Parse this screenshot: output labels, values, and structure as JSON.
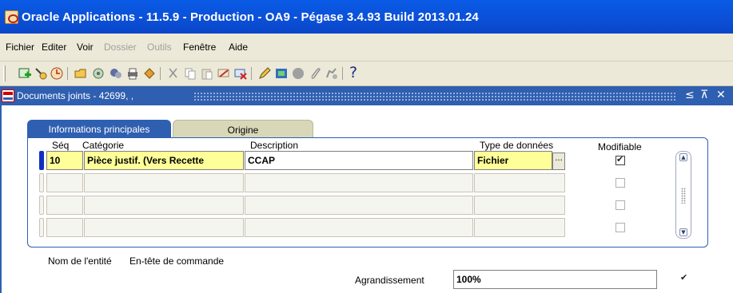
{
  "window": {
    "title": "Oracle Applications - 11.5.9 - Production - OA9 - Pégase 3.4.93 Build 2013.01.24"
  },
  "menubar": {
    "items": [
      {
        "label": "Fichier",
        "enabled": true
      },
      {
        "label": "Editer",
        "enabled": true
      },
      {
        "label": "Voir",
        "enabled": true
      },
      {
        "label": "Dossier",
        "enabled": false
      },
      {
        "label": "Outils",
        "enabled": false
      },
      {
        "label": "Fenêtre",
        "enabled": true
      },
      {
        "label": "Aide",
        "enabled": true
      }
    ]
  },
  "toolbar": {
    "icons": [
      "new-record-icon",
      "find-icon",
      "navigator-icon",
      "open-folder-icon",
      "save-icon",
      "switch-responsibility-icon",
      "print-icon",
      "close-form-icon",
      "cut-icon",
      "copy-icon",
      "paste-icon",
      "clear-record-icon",
      "delete-icon",
      "edit-field-icon",
      "zoom-icon",
      "translations-icon",
      "attachments-icon",
      "folder-tools-icon",
      "help-icon"
    ],
    "help_glyph": "?"
  },
  "inner_window": {
    "title": "Documents joints - 42699, ,",
    "controls": [
      "≤",
      "⊼",
      "✕"
    ]
  },
  "tabs": [
    {
      "label": "Informations principales",
      "active": true
    },
    {
      "label": "Origine",
      "active": false
    }
  ],
  "table": {
    "headers": {
      "seq": "Séq",
      "category": "Catégorie",
      "description": "Description",
      "datatype": "Type de données",
      "modifiable": "Modifiable"
    },
    "rows": [
      {
        "seq": "10",
        "category": "Pièce justif. (Vers Recette",
        "description": "CCAP",
        "datatype": "Fichier",
        "modifiable": true
      },
      {
        "seq": "",
        "category": "",
        "description": "",
        "datatype": "",
        "modifiable": false
      },
      {
        "seq": "",
        "category": "",
        "description": "",
        "datatype": "",
        "modifiable": false
      },
      {
        "seq": "",
        "category": "",
        "description": "",
        "datatype": "",
        "modifiable": false
      }
    ],
    "lov_glyph": "..."
  },
  "footer": {
    "entity_label": "Nom de l'entité",
    "entity_value": "En-tête de commande",
    "zoom_label": "Agrandissement",
    "zoom_value": "100%",
    "zoom_checked": true
  },
  "colors": {
    "title_bar": "#0b4fd6",
    "inner_bar": "#2f5fb0",
    "current_row_field": "#ffff99",
    "chrome": "#ece9d8"
  }
}
